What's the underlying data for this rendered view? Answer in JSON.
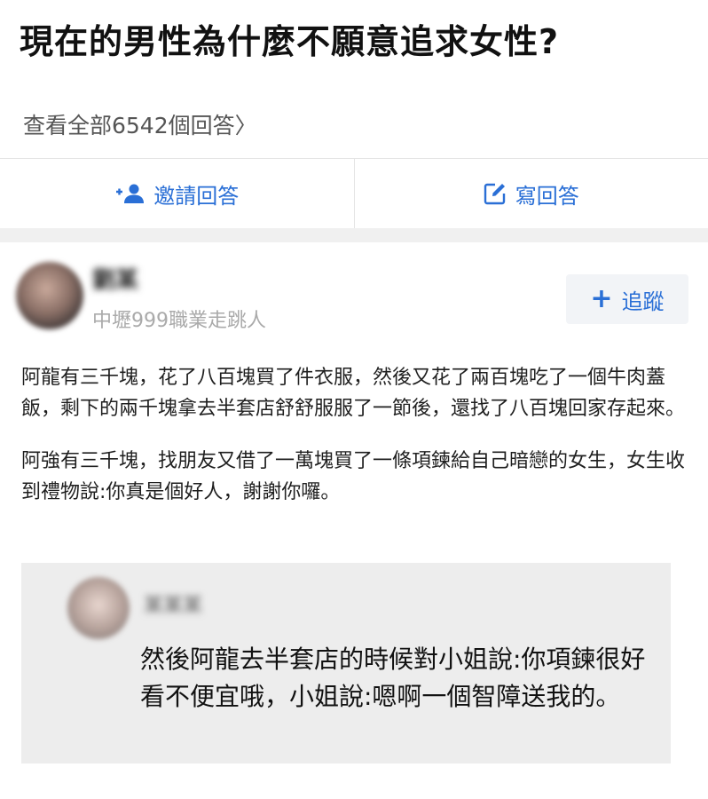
{
  "question": {
    "title": "現在的男性為什麼不願意追求女性?",
    "view_all": "查看全部6542個回答〉"
  },
  "actions": {
    "invite_label": "邀請回答",
    "write_label": "寫回答"
  },
  "answer": {
    "author_name": "劉某",
    "author_bio": "中壢999職業走跳人",
    "follow_label": "追蹤",
    "paragraphs": [
      "阿龍有三千塊，花了八百塊買了件衣服，然後又花了兩百塊吃了一個牛肉蓋飯，剩下的兩千塊拿去半套店舒舒服服了一節後，還找了八百塊回家存起來。",
      "阿強有三千塊，找朋友又借了一萬塊買了一條項鍊給自己暗戀的女生，女生收到禮物說:你真是個好人，謝謝你囉。"
    ]
  },
  "comment": {
    "author_name": "某某某",
    "text": "然後阿龍去半套店的時候對小姐說:你項鍊很好看不便宜哦，小姐說:嗯啊一個智障送我的。"
  },
  "icons": {
    "invite": "add-user-icon",
    "write": "edit-icon",
    "follow": "plus-icon"
  },
  "colors": {
    "accent": "#2a6fd6"
  }
}
